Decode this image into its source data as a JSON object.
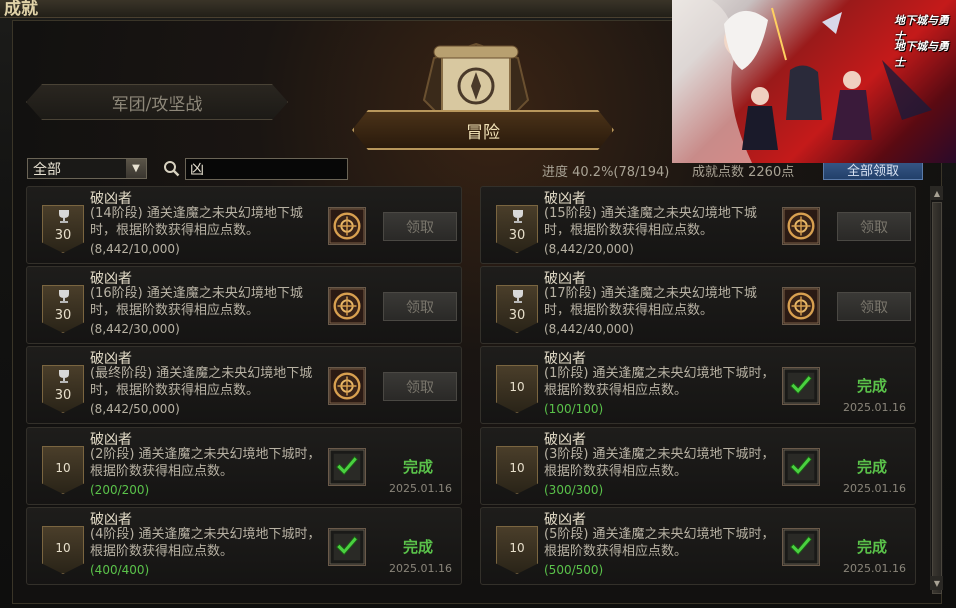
{
  "window": {
    "title": "成就"
  },
  "tabs": [
    {
      "label": "军团/攻坚战",
      "active": false
    },
    {
      "label": "冒险",
      "active": true
    }
  ],
  "filter": {
    "selected": "全部"
  },
  "search": {
    "value": "凶"
  },
  "stats": {
    "progress": "进度 40.2%(78/194)",
    "points": "成就点数 2260点",
    "claim_all_label": "全部领取"
  },
  "achievements": [
    {
      "name": "破凶者",
      "desc": "(14阶段) 通关逢魔之未央幻境地下城时，根据阶数获得相应点数。",
      "count": "(8,442/10,000)",
      "points": "30",
      "done": false,
      "action": "领取"
    },
    {
      "name": "破凶者",
      "desc": "(15阶段) 通关逢魔之未央幻境地下城时，根据阶数获得相应点数。",
      "count": "(8,442/20,000)",
      "points": "30",
      "done": false,
      "action": "领取"
    },
    {
      "name": "破凶者",
      "desc": "(16阶段) 通关逢魔之未央幻境地下城时，根据阶数获得相应点数。",
      "count": "(8,442/30,000)",
      "points": "30",
      "done": false,
      "action": "领取"
    },
    {
      "name": "破凶者",
      "desc": "(17阶段) 通关逢魔之未央幻境地下城时，根据阶数获得相应点数。",
      "count": "(8,442/40,000)",
      "points": "30",
      "done": false,
      "action": "领取"
    },
    {
      "name": "破凶者",
      "desc": "(最终阶段) 通关逢魔之未央幻境地下城时，根据阶数获得相应点数。",
      "count": "(8,442/50,000)",
      "points": "30",
      "done": false,
      "action": "领取"
    },
    {
      "name": "破凶者",
      "desc": "(1阶段) 通关逢魔之未央幻境地下城时，根据阶数获得相应点数。",
      "count": "(100/100)",
      "points": "10",
      "done": true,
      "status": "完成",
      "date": "2025.01.16"
    },
    {
      "name": "破凶者",
      "desc": "(2阶段) 通关逢魔之未央幻境地下城时，根据阶数获得相应点数。",
      "count": "(200/200)",
      "points": "10",
      "done": true,
      "status": "完成",
      "date": "2025.01.16"
    },
    {
      "name": "破凶者",
      "desc": "(3阶段) 通关逢魔之未央幻境地下城时，根据阶数获得相应点数。",
      "count": "(300/300)",
      "points": "10",
      "done": true,
      "status": "完成",
      "date": "2025.01.16"
    },
    {
      "name": "破凶者",
      "desc": "(4阶段) 通关逢魔之未央幻境地下城时，根据阶数获得相应点数。",
      "count": "(400/400)",
      "points": "10",
      "done": true,
      "status": "完成",
      "date": "2025.01.16"
    },
    {
      "name": "破凶者",
      "desc": "(5阶段) 通关逢魔之未央幻境地下城时，根据阶数获得相应点数。",
      "count": "(500/500)",
      "points": "10",
      "done": true,
      "status": "完成",
      "date": "2025.01.16"
    }
  ],
  "overlay": {
    "logo_text": "地下城与勇士"
  },
  "icons": {
    "search": "search-icon",
    "reward_unclaimed": "emblem-reward-icon",
    "reward_done": "checkmark-reward-icon",
    "trophy": "trophy-icon"
  },
  "colors": {
    "complete": "#5ac24a",
    "claim_all_bg": "#2e4e7a",
    "active_tab_border": "#b8975c"
  }
}
